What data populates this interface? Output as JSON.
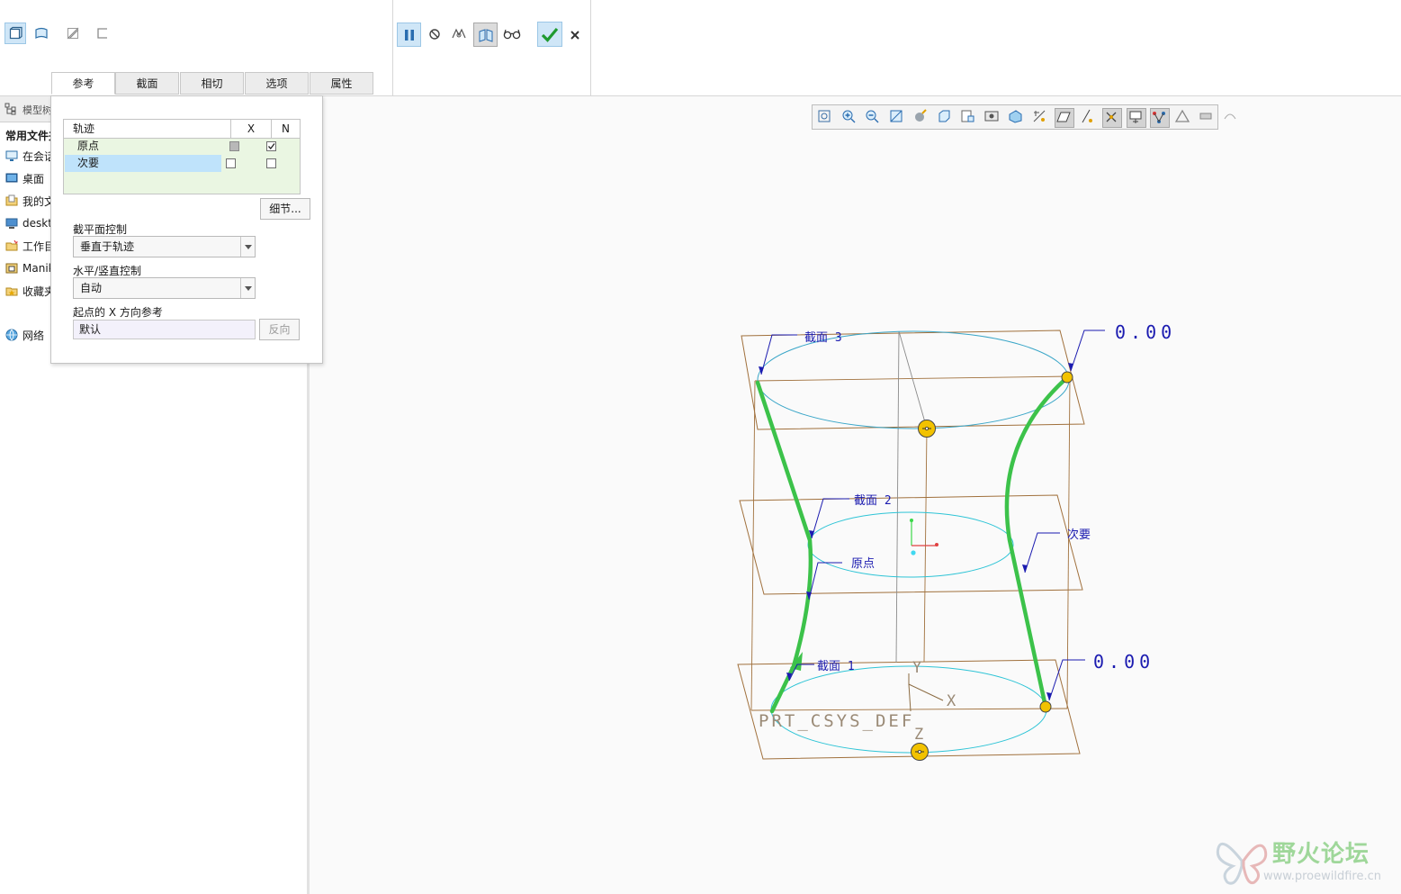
{
  "ribbon": {
    "left_icons": [
      "solid-icon",
      "surface-icon",
      "thin-icon",
      "cut-icon"
    ],
    "control_icons": [
      "pause-icon",
      "no-preview-icon",
      "preview-icon",
      "verify-icon",
      "glasses-icon"
    ],
    "ok_icon": "checkmark-icon",
    "cancel_icon": "close-icon",
    "tabs": [
      {
        "label": "参考"
      },
      {
        "label": "截面"
      },
      {
        "label": "相切"
      },
      {
        "label": "选项"
      },
      {
        "label": "属性"
      }
    ]
  },
  "model_tree": {
    "header": "模型树",
    "section_title": "常用文件夹",
    "items": [
      {
        "label": "在会话中",
        "icon": "session-icon"
      },
      {
        "label": "桌面",
        "icon": "desktop-icon"
      },
      {
        "label": "我的文档",
        "icon": "documents-icon"
      },
      {
        "label": "desktop",
        "icon": "computer-icon"
      },
      {
        "label": "工作目录",
        "icon": "work-folder-icon"
      },
      {
        "label": "Manikin",
        "icon": "manikin-icon"
      },
      {
        "label": "收藏夹",
        "icon": "favorites-icon"
      },
      {
        "label": "网络",
        "icon": "network-icon"
      }
    ]
  },
  "references_panel": {
    "table": {
      "headers": [
        "轨迹",
        "X",
        "N"
      ],
      "rows": [
        {
          "name": "原点",
          "x": "grey",
          "n": true
        },
        {
          "name": "次要",
          "x": false,
          "n": false,
          "selected": true
        }
      ]
    },
    "details_button": "细节...",
    "section_plane_label": "截平面控制",
    "section_plane_value": "垂直于轨迹",
    "hv_control_label": "水平/竖直控制",
    "hv_control_value": "自动",
    "x_ref_label": "起点的 X 方向参考",
    "x_ref_value": "默认",
    "flip_button": "反向"
  },
  "graphics_toolbar": {
    "icons": [
      "refit-icon",
      "zoom-in-icon",
      "zoom-out-icon",
      "repaint-icon",
      "perspective-icon",
      "saved-views-icon",
      "named-view-icon",
      "display-style-icon",
      "section-icon",
      "datum-display-icon",
      "plane-display-icon",
      "axis-display-icon",
      "point-display-icon",
      "csys-display-icon",
      "annotation-display-icon",
      "spin-center-icon",
      "appearance-icon",
      "shade-icon"
    ],
    "pressed": [
      10,
      12,
      13,
      14
    ]
  },
  "model": {
    "labels": {
      "section3": "截面 3",
      "section2": "截面 2",
      "section1": "截面 1",
      "origin": "原点",
      "secondary": "次要",
      "dim_top": "0.00",
      "dim_bottom": "0.00",
      "csys": "PRT_CSYS_DEF",
      "axis_x": "X",
      "axis_y": "Y",
      "axis_z": "Z"
    },
    "colors": {
      "trajectory": "#3cc24a",
      "section_ellipse": "#2ec4d6",
      "datum_plane": "#a0703c",
      "annotation": "#1b1bb0",
      "handle": "#f2c200"
    }
  },
  "watermark": {
    "title": "野火论坛",
    "url": "www.proewildfire.cn"
  }
}
